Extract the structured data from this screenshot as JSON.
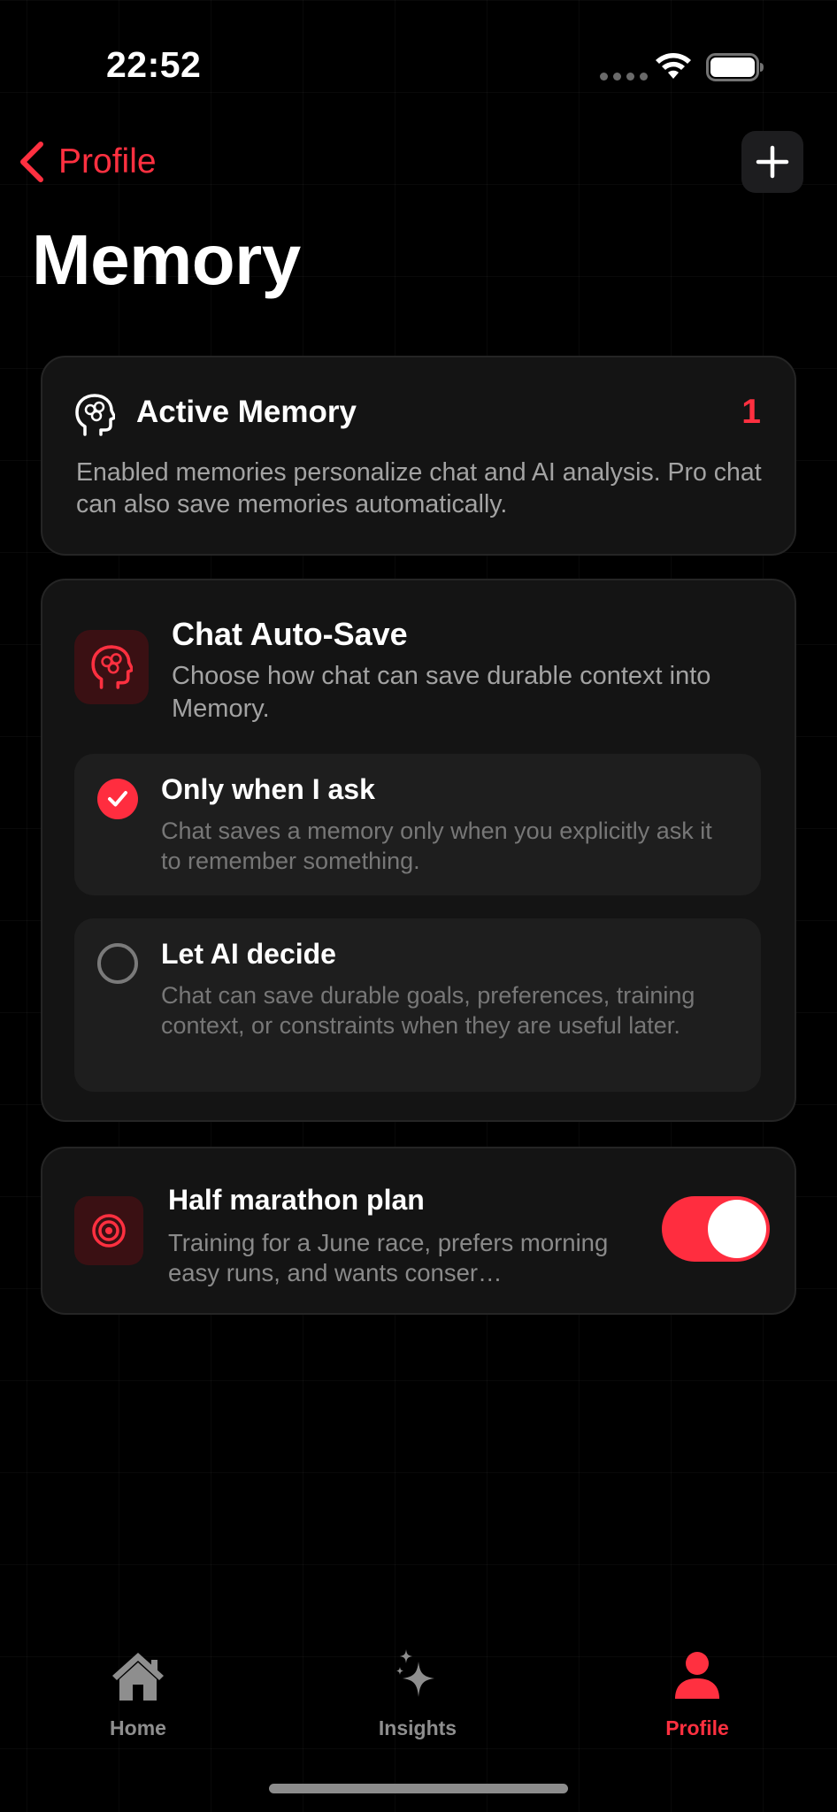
{
  "status_bar": {
    "time": "22:52"
  },
  "nav": {
    "back_label": "Profile",
    "title": "Memory"
  },
  "active_memory": {
    "icon": "head-brain-icon",
    "title": "Active Memory",
    "count": "1",
    "description": "Enabled memories personalize chat and AI analysis. Pro chat can also save memories automatically."
  },
  "chat_autosave": {
    "icon": "head-brain-icon",
    "title": "Chat Auto-Save",
    "description": "Choose how chat can save durable context into Memory.",
    "options": [
      {
        "title": "Only when I ask",
        "description": "Chat saves a memory only when you explicitly ask it to remember something.",
        "selected": true
      },
      {
        "title": "Let AI decide",
        "description": "Chat can save durable goals, preferences, training context, or constraints when they are useful later.",
        "selected": false
      }
    ]
  },
  "memories": [
    {
      "icon": "target-icon",
      "title": "Half marathon plan",
      "description": "Training for a June race, prefers morning easy runs, and wants conser…",
      "enabled": true
    }
  ],
  "tab_bar": {
    "tabs": [
      {
        "label": "Home",
        "icon": "house-icon",
        "active": false
      },
      {
        "label": "Insights",
        "icon": "sparkles-icon",
        "active": false
      },
      {
        "label": "Profile",
        "icon": "person-icon",
        "active": true
      }
    ]
  },
  "colors": {
    "accent": "#ff2d3f",
    "background": "#000000",
    "card": "#141414",
    "secondary_text": "#a3a3a3"
  }
}
